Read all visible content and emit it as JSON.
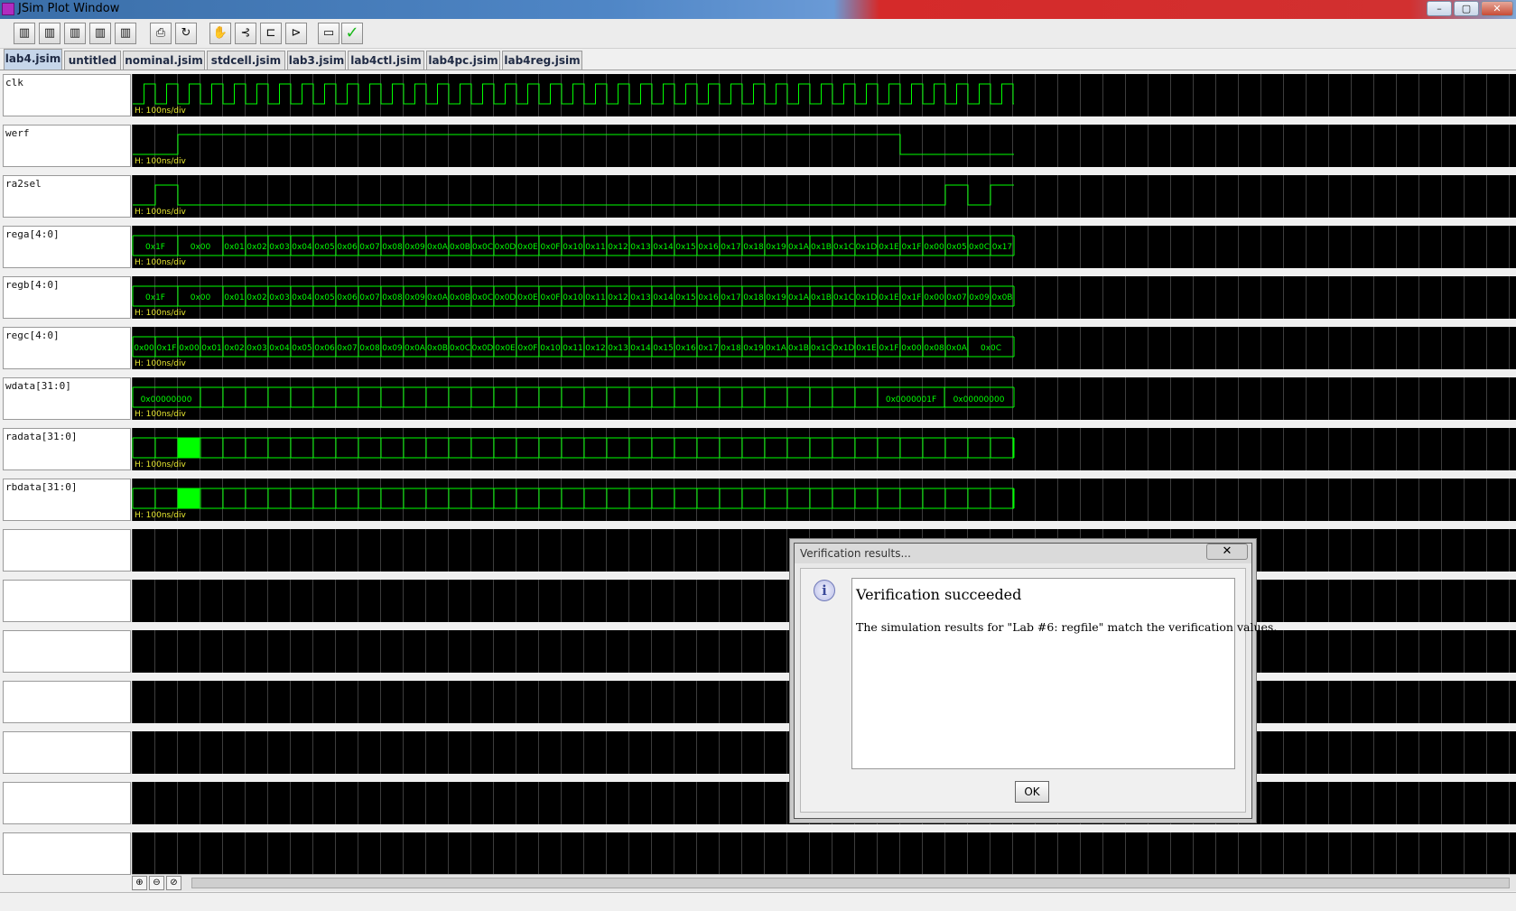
{
  "window": {
    "title": "JSim Plot Window",
    "controls": {
      "minimize": "–",
      "maximize": "▢",
      "close": "✕"
    }
  },
  "toolbar": {
    "buttons": [
      {
        "icon": "plot-view-1-icon",
        "glyph": "▥"
      },
      {
        "icon": "plot-view-2-icon",
        "glyph": "▥"
      },
      {
        "icon": "plot-view-3-icon",
        "glyph": "▥"
      },
      {
        "icon": "plot-view-4-icon",
        "glyph": "▥"
      },
      {
        "icon": "plot-view-5-icon",
        "glyph": "▥"
      },
      {
        "icon": "print-icon",
        "glyph": "⎙"
      },
      {
        "icon": "refresh-icon",
        "glyph": "↻"
      },
      {
        "icon": "hand-icon",
        "glyph": "✋"
      },
      {
        "icon": "split-icon",
        "glyph": "⊰"
      },
      {
        "icon": "timing-icon",
        "glyph": "⊏"
      },
      {
        "icon": "gate-icon",
        "glyph": "⊳"
      },
      {
        "icon": "window-icon",
        "glyph": "▭"
      },
      {
        "icon": "checkmark-icon",
        "glyph": "✓"
      }
    ]
  },
  "tabs": [
    "lab4.jsim",
    "untitled",
    "nominal.jsim",
    "stdcell.jsim",
    "lab3.jsim",
    "lab4ctl.jsim",
    "lab4pc.jsim",
    "lab4reg.jsim"
  ],
  "active_tab": "lab4.jsim",
  "signals": [
    {
      "name": "clk",
      "scale": "H: 100ns/div",
      "kind": "clock"
    },
    {
      "name": "werf",
      "scale": "H: 100ns/div",
      "kind": "werf"
    },
    {
      "name": "ra2sel",
      "scale": "H: 100ns/div",
      "kind": "ra2sel"
    },
    {
      "name": "rega[4:0]",
      "scale": "H: 100ns/div",
      "kind": "bus",
      "values": [
        "0x1F",
        "0x00",
        "0x01",
        "0x02",
        "0x03",
        "0x04",
        "0x05",
        "0x06",
        "0x07",
        "0x08",
        "0x09",
        "0x0A",
        "0x0B",
        "0x0C",
        "0x0D",
        "0x0E",
        "0x0F",
        "0x10",
        "0x11",
        "0x12",
        "0x13",
        "0x14",
        "0x15",
        "0x16",
        "0x17",
        "0x18",
        "0x19",
        "0x1A",
        "0x1B",
        "0x1C",
        "0x1D",
        "0x1E",
        "0x1F",
        "0x00",
        "0x05",
        "0x0C",
        "0x17"
      ]
    },
    {
      "name": "regb[4:0]",
      "scale": "H: 100ns/div",
      "kind": "bus",
      "values": [
        "0x1F",
        "0x00",
        "0x01",
        "0x02",
        "0x03",
        "0x04",
        "0x05",
        "0x06",
        "0x07",
        "0x08",
        "0x09",
        "0x0A",
        "0x0B",
        "0x0C",
        "0x0D",
        "0x0E",
        "0x0F",
        "0x10",
        "0x11",
        "0x12",
        "0x13",
        "0x14",
        "0x15",
        "0x16",
        "0x17",
        "0x18",
        "0x19",
        "0x1A",
        "0x1B",
        "0x1C",
        "0x1D",
        "0x1E",
        "0x1F",
        "0x00",
        "0x07",
        "0x09",
        "0x0B"
      ]
    },
    {
      "name": "regc[4:0]",
      "scale": "H: 100ns/div",
      "kind": "bus",
      "values": [
        "0x00",
        "0x1F",
        "0x00",
        "0x01",
        "0x02",
        "0x03",
        "0x04",
        "0x05",
        "0x06",
        "0x07",
        "0x08",
        "0x09",
        "0x0A",
        "0x0B",
        "0x0C",
        "0x0D",
        "0x0E",
        "0x0F",
        "0x10",
        "0x11",
        "0x12",
        "0x13",
        "0x14",
        "0x15",
        "0x16",
        "0x17",
        "0x18",
        "0x19",
        "0x1A",
        "0x1B",
        "0x1C",
        "0x1D",
        "0x1E",
        "0x1F",
        "0x00",
        "0x08",
        "0x0A",
        "0x0C"
      ]
    },
    {
      "name": "wdata[31:0]",
      "scale": "H: 100ns/div",
      "kind": "bus",
      "values": [
        "0x00000000",
        "0x0000001F",
        "0x00000000"
      ]
    },
    {
      "name": "radata[31:0]",
      "scale": "H: 100ns/div",
      "kind": "data"
    },
    {
      "name": "rbdata[31:0]",
      "scale": "H: 100ns/div",
      "kind": "data"
    },
    {
      "name": "",
      "scale": "",
      "kind": "empty"
    },
    {
      "name": "",
      "scale": "",
      "kind": "empty"
    },
    {
      "name": "",
      "scale": "",
      "kind": "empty"
    },
    {
      "name": "",
      "scale": "",
      "kind": "empty"
    },
    {
      "name": "",
      "scale": "",
      "kind": "empty"
    },
    {
      "name": "",
      "scale": "",
      "kind": "empty"
    },
    {
      "name": "",
      "scale": "",
      "kind": "empty"
    }
  ],
  "zoom": {
    "buttons": [
      "zoom-in-icon",
      "zoom-out-icon",
      "zoom-fit-icon"
    ],
    "glyphs": [
      "⊕",
      "⊖",
      "⊘"
    ]
  },
  "dialog": {
    "title": "Verification results...",
    "close": "✕",
    "info_glyph": "i",
    "heading": "Verification succeeded",
    "message": "The simulation results for \"Lab #6: regfile\" match the verification values.",
    "ok_label": "OK"
  },
  "colors": {
    "trace": "#00ff00",
    "grid": "#3d3d3d",
    "scale_text": "#e8e830",
    "plot_bg": "#000000"
  }
}
